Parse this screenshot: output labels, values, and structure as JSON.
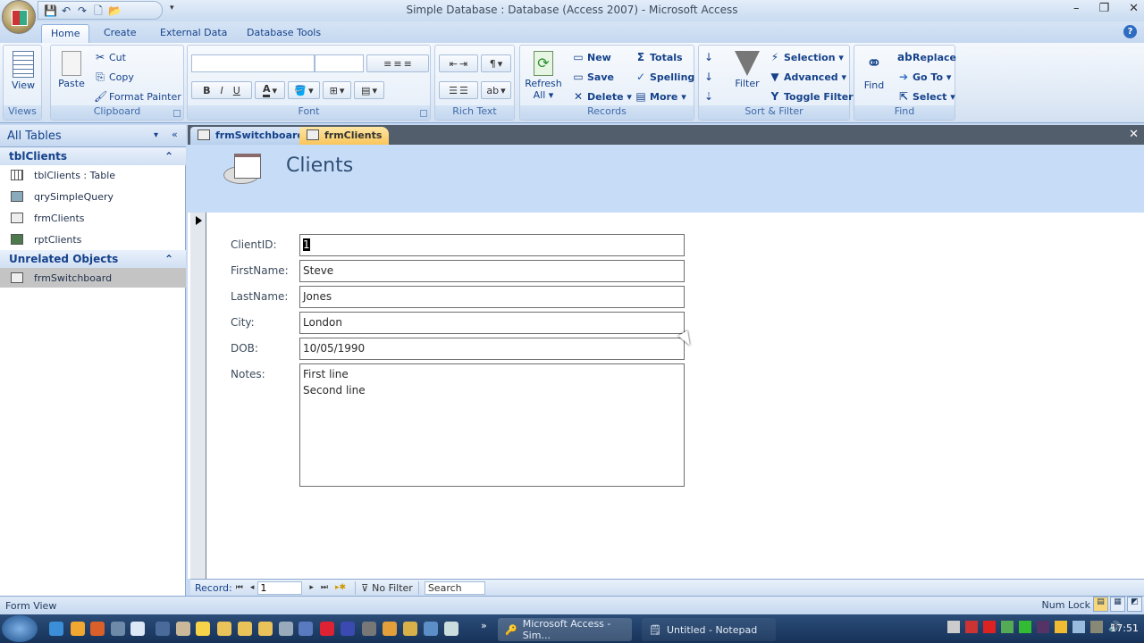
{
  "window": {
    "title": "Simple Database : Database (Access 2007) - Microsoft Access",
    "controls": [
      "minimize",
      "restore",
      "close"
    ]
  },
  "quick_access": {
    "icons": [
      "save-icon",
      "undo-icon",
      "redo-icon",
      "new-icon",
      "open-icon"
    ],
    "more": "▾"
  },
  "ribbon": {
    "tabs": [
      {
        "label": "Home",
        "active": true
      },
      {
        "label": "Create"
      },
      {
        "label": "External Data"
      },
      {
        "label": "Database Tools"
      }
    ],
    "groups": {
      "views": {
        "label": "Views",
        "view": "View"
      },
      "clipboard": {
        "label": "Clipboard",
        "paste": "Paste",
        "cut": "Cut",
        "copy": "Copy",
        "format_painter": "Format Painter"
      },
      "font": {
        "label": "Font",
        "font_name": "",
        "font_size": "",
        "bold": "B",
        "italic": "I",
        "underline": "U"
      },
      "rich_text": {
        "label": "Rich Text"
      },
      "records": {
        "label": "Records",
        "refresh": "Refresh",
        "refresh2": "All ▾",
        "new": "New",
        "save": "Save",
        "delete": "Delete ▾",
        "totals": "Totals",
        "spelling": "Spelling",
        "more": "More ▾"
      },
      "sort_filter": {
        "label": "Sort & Filter",
        "filter": "Filter",
        "selection": "Selection ▾",
        "advanced": "Advanced ▾",
        "toggle_filter": "Toggle Filter"
      },
      "find": {
        "label": "Find",
        "find": "Find",
        "replace": "Replace",
        "goto": "Go To ▾",
        "select": "Select ▾"
      }
    }
  },
  "nav_pane": {
    "header": "All Tables",
    "groups": [
      {
        "label": "tblClients",
        "items": [
          {
            "label": "tblClients : Table",
            "icon": "table-icon"
          },
          {
            "label": "qrySimpleQuery",
            "icon": "query-icon"
          },
          {
            "label": "frmClients",
            "icon": "form-icon"
          },
          {
            "label": "rptClients",
            "icon": "report-icon"
          }
        ]
      },
      {
        "label": "Unrelated Objects",
        "items": [
          {
            "label": "frmSwitchboard",
            "icon": "form-icon",
            "selected": true
          }
        ]
      }
    ]
  },
  "doc_tabs": [
    {
      "label": "frmSwitchboard",
      "active": false
    },
    {
      "label": "frmClients",
      "active": true
    }
  ],
  "form": {
    "title": "Clients",
    "fields": [
      {
        "label": "ClientID:",
        "value": "1"
      },
      {
        "label": "FirstName:",
        "value": "Steve"
      },
      {
        "label": "LastName:",
        "value": "Jones"
      },
      {
        "label": "City:",
        "value": "London"
      },
      {
        "label": "DOB:",
        "value": "10/05/1990"
      },
      {
        "label": "Notes:",
        "value": "First line\nSecond line"
      }
    ]
  },
  "record_nav": {
    "label": "Record:",
    "current": "1",
    "filter": "No Filter",
    "search": "Search"
  },
  "status": {
    "view": "Form View",
    "numlock": "Num Lock"
  },
  "taskbar": {
    "tasks": [
      "Microsoft Access - Sim...",
      "Untitled - Notepad"
    ],
    "clock": "17:51",
    "overflow": "»"
  }
}
